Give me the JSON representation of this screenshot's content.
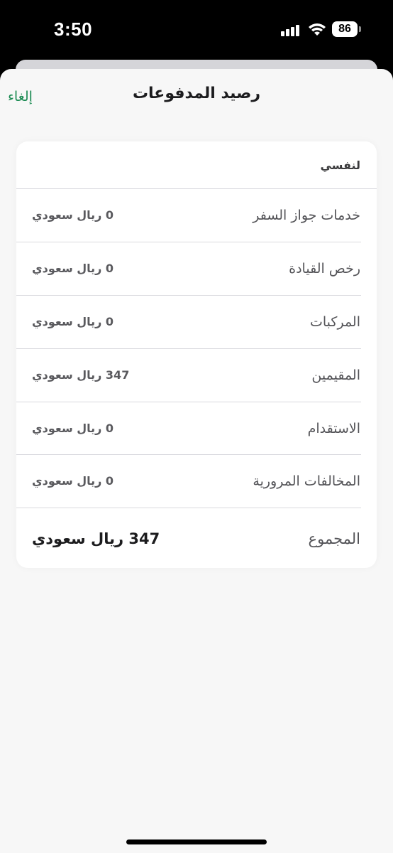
{
  "status_bar": {
    "time": "3:50",
    "battery": "86",
    "icons": [
      "signal-icon",
      "wifi-icon",
      "battery-icon"
    ]
  },
  "nav": {
    "title": "رصيد المدفوعات",
    "cancel": "إلغاء",
    "accent_color": "#1a8a52"
  },
  "card": {
    "header": "لنفسي",
    "rows": [
      {
        "label": "خدمات جواز السفر",
        "value": "0 ريال سعودي"
      },
      {
        "label": "رخص القيادة",
        "value": "0 ريال سعودي"
      },
      {
        "label": "المركبات",
        "value": "0 ريال سعودي"
      },
      {
        "label": "المقيمين",
        "value": "347 ريال سعودي"
      },
      {
        "label": "الاستقدام",
        "value": "0 ريال سعودي"
      },
      {
        "label": "المخالفات المرورية",
        "value": "0 ريال سعودي"
      }
    ],
    "total": {
      "label": "المجموع",
      "value": "347 ريال سعودي"
    }
  }
}
